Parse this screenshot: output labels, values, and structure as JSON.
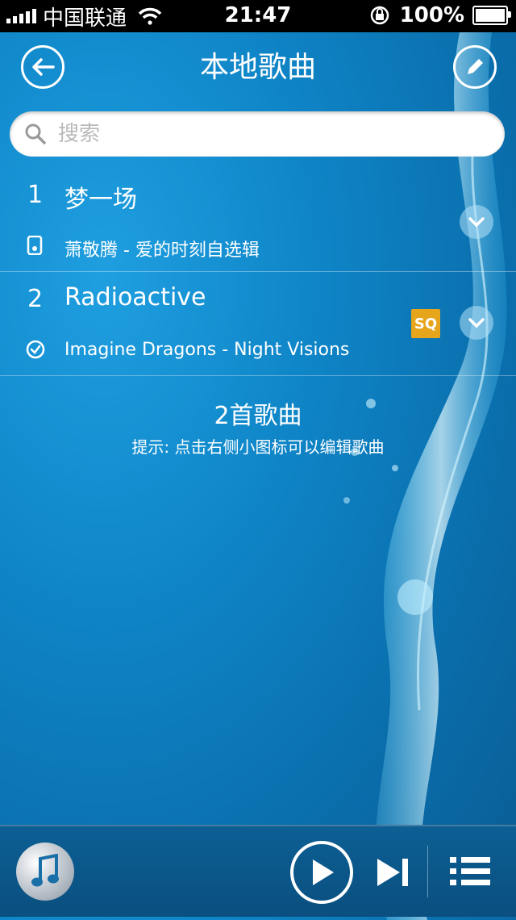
{
  "status_bar": {
    "carrier": "中国联通",
    "time": "21:47",
    "battery": "100%"
  },
  "nav": {
    "title": "本地歌曲"
  },
  "search": {
    "placeholder": "搜索"
  },
  "songs": [
    {
      "index": "1",
      "title": "梦一场",
      "subtitle": "萧敬腾 - 爱的时刻自选辑",
      "status_icon": "ipod-icon"
    },
    {
      "index": "2",
      "title": "Radioactive",
      "subtitle": "Imagine Dragons - Night Visions",
      "status_icon": "check-circle-icon",
      "badge": "SQ"
    }
  ],
  "summary": {
    "count": "2首歌曲",
    "hint": "提示: 点击右侧小图标可以编辑歌曲"
  },
  "colors": {
    "sq_badge": "#e6a51a",
    "background": "#0f86c8"
  }
}
